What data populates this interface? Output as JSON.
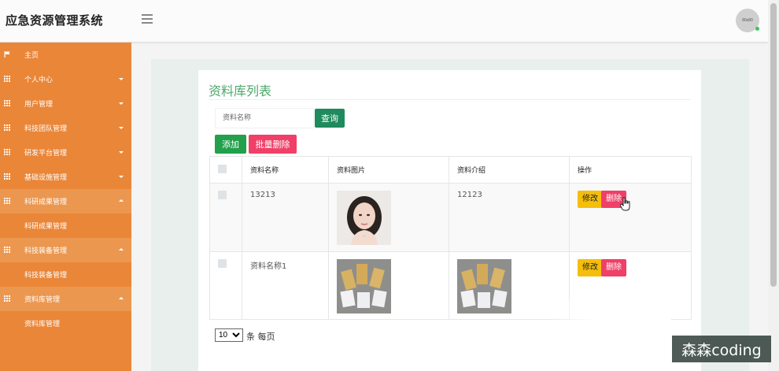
{
  "app": {
    "title": "应急资源管理系统",
    "avatar_text": "80x80"
  },
  "sidebar": {
    "items": [
      {
        "label": "主页"
      },
      {
        "label": "个人中心"
      },
      {
        "label": "用户管理"
      },
      {
        "label": "科技团队管理"
      },
      {
        "label": "研发平台管理"
      },
      {
        "label": "基础设施管理"
      },
      {
        "label": "科研成果管理",
        "sub": "科研成果管理"
      },
      {
        "label": "科技装备管理",
        "sub": "科技装备管理"
      },
      {
        "label": "资料库管理",
        "sub": "资料库管理"
      }
    ]
  },
  "main": {
    "title": "资料库列表",
    "search": {
      "placeholder": "资料名称",
      "button": "查询"
    },
    "actions": {
      "add": "添加",
      "batch_delete": "批量删除"
    },
    "table": {
      "headers": [
        "资料名称",
        "资料图片",
        "资料介绍",
        "操作"
      ],
      "rows": [
        {
          "name": "13213",
          "intro": "12123",
          "image": "portrait",
          "edit": "修改",
          "delete": "删除"
        },
        {
          "name": "资料名称1",
          "intro": "",
          "image": "packets",
          "edit": "修改",
          "delete": "删除"
        }
      ]
    },
    "pagination": {
      "page_size": "10",
      "suffix": "条 每页"
    }
  },
  "watermark": "森森coding",
  "colors": {
    "sidebar": "#ea8638",
    "accent_green": "#4da86b",
    "danger": "#f04067",
    "warning": "#f5be0b"
  }
}
